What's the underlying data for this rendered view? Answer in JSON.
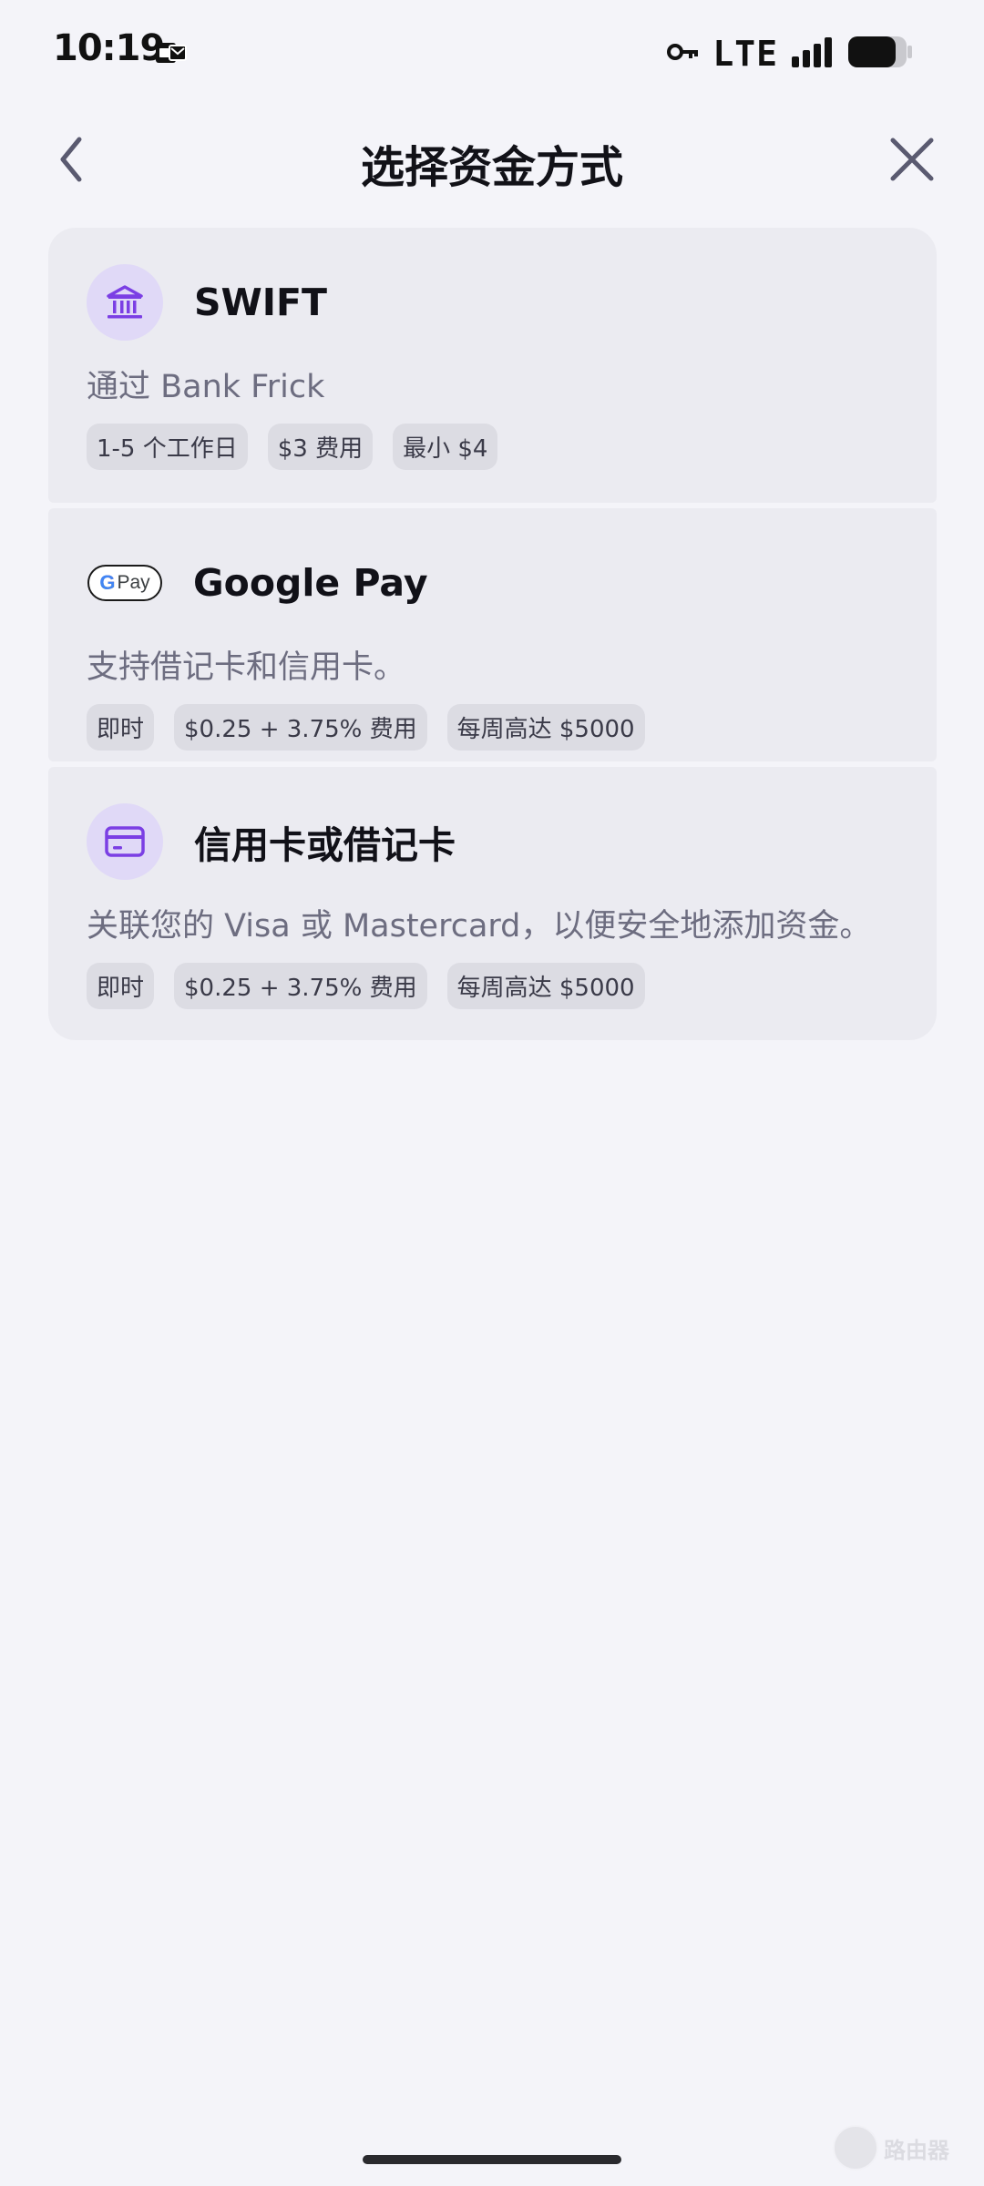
{
  "status_bar": {
    "time": "10:19",
    "network": "LTE"
  },
  "header": {
    "title": "选择资金方式"
  },
  "methods": [
    {
      "name": "SWIFT",
      "icon": "bank-icon",
      "description": "通过 Bank Frick",
      "chips": [
        "1-5 个工作日",
        "$3 费用",
        "最小 $4"
      ]
    },
    {
      "name": "Google Pay",
      "icon": "google-pay-logo",
      "logo_text": {
        "g": "G",
        "pay": "Pay"
      },
      "description": "支持借记卡和信用卡。",
      "chips": [
        "即时",
        "$0.25 + 3.75% 费用",
        "每周高达 $5000"
      ]
    },
    {
      "name": "信用卡或借记卡",
      "icon": "credit-card-icon",
      "description": "关联您的 Visa 或 Mastercard，以便安全地添加资金。",
      "chips": [
        "即时",
        "$0.25 + 3.75% 费用",
        "每周高达 $5000"
      ]
    }
  ],
  "watermark": {
    "text": "路由器"
  },
  "colors": {
    "background": "#f4f4f9",
    "card": "#ebebf1",
    "chip": "#dcdce3",
    "icon_bg": "#e0d9f7",
    "accent": "#7b3fe4"
  }
}
